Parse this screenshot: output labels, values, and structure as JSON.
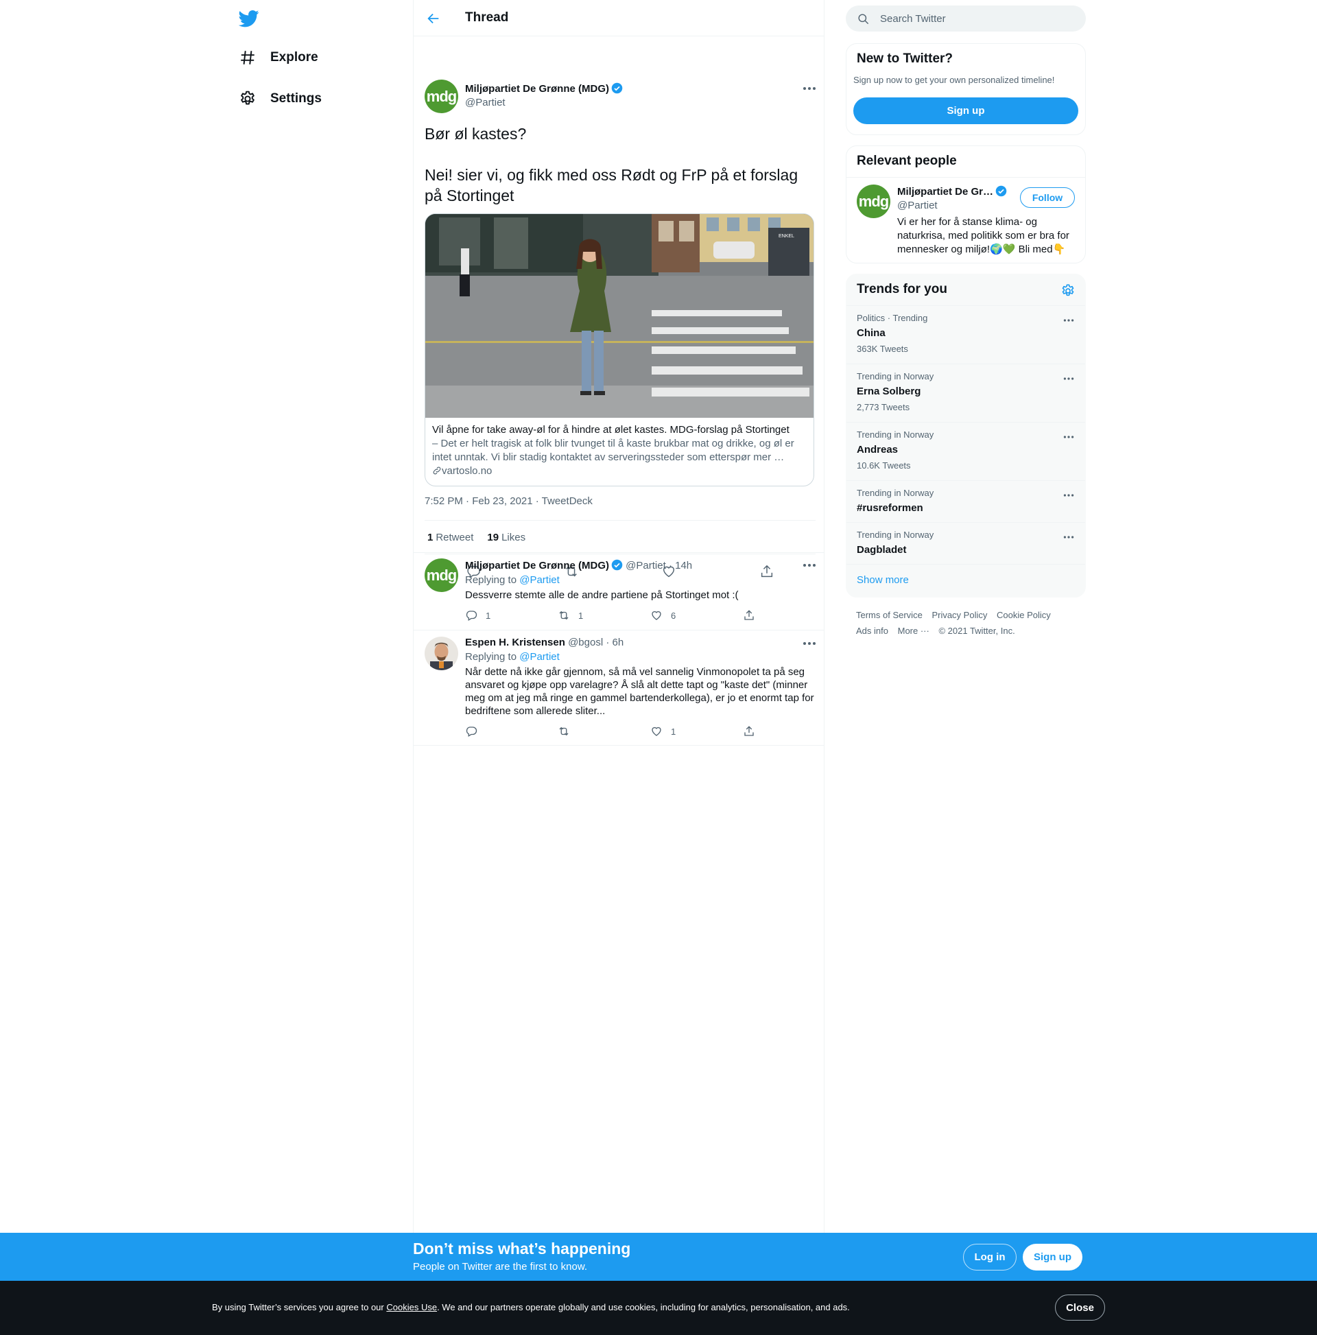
{
  "nav": {
    "items": [
      {
        "label": "Explore",
        "icon": "hashtag-icon"
      },
      {
        "label": "Settings",
        "icon": "gear-icon"
      }
    ]
  },
  "thread": {
    "title": "Thread",
    "main_tweet": {
      "avatar_text": "mdg",
      "name": "Miljøpartiet De Grønne (MDG)",
      "handle": "@Partiet",
      "text_line1": "Bør øl kastes?",
      "text_line2": "Nei! sier vi, og fikk med oss Rødt og FrP på et forslag på Stortinget",
      "card": {
        "title": "Vil åpne for take away-øl for å hindre at ølet kastes. MDG-forslag på Stortinget",
        "description": "– Det er helt tragisk at folk blir tvunget til å kaste brukbar mat og drikke, og øl er intet unntak. Vi blir stadig kontaktet av serveringssteder som etterspør mer …",
        "domain": "vartoslo.no",
        "image_sign": "ENKEL"
      },
      "timestamp": "7:52 PM · Feb 23, 2021",
      "source": "TweetDeck",
      "retweets_count": "1",
      "retweets_label": "Retweet",
      "likes_count": "19",
      "likes_label": "Likes"
    },
    "replies": [
      {
        "avatar_text": "mdg",
        "name": "Miljøpartiet De Grønne (MDG)",
        "handle": "@Partiet",
        "time": "· 14h",
        "replying_label": "Replying to",
        "replying_to": "@Partiet",
        "text": "Dessverre stemte alle de andre partiene på Stortinget mot :(",
        "reply_count": "1",
        "retweet_count": "1",
        "like_count": "6"
      },
      {
        "name": "Espen H. Kristensen",
        "handle": "@bgosl",
        "time": "· 6h",
        "replying_label": "Replying to",
        "replying_to": "@Partiet",
        "text": "Når dette nå ikke går gjennom, så må vel sannelig Vinmonopolet ta på seg ansvaret og kjøpe opp varelagre? Å slå alt dette tapt og \"kaste det\" (minner meg om at jeg må ringe en gammel bartenderkollega), er jo et enormt tap for bedriftene som allerede sliter...",
        "like_count": "1"
      }
    ]
  },
  "sidebar": {
    "search_placeholder": "Search Twitter",
    "new_to_twitter": {
      "title": "New to Twitter?",
      "subtitle": "Sign up now to get your own personalized timeline!",
      "button": "Sign up"
    },
    "relevant_people": {
      "title": "Relevant people",
      "avatar_text": "mdg",
      "name": "Miljøpartiet De Gr…",
      "handle": "@Partiet",
      "follow": "Follow",
      "bio": "Vi er her for å stanse klima- og naturkrisa, med politikk som er bra for mennesker og miljø!🌍💚 Bli med👇"
    },
    "trends": {
      "title": "Trends for you",
      "items": [
        {
          "category": "Politics · Trending",
          "name": "China",
          "count": "363K Tweets"
        },
        {
          "category": "Trending in Norway",
          "name": "Erna Solberg",
          "count": "2,773 Tweets"
        },
        {
          "category": "Trending in Norway",
          "name": "Andreas",
          "count": "10.6K Tweets"
        },
        {
          "category": "Trending in Norway",
          "name": "#rusreformen",
          "count": ""
        },
        {
          "category": "Trending in Norway",
          "name": "Dagbladet",
          "count": ""
        }
      ],
      "show_more": "Show more"
    },
    "footer": {
      "terms": "Terms of Service",
      "privacy": "Privacy Policy",
      "cookie": "Cookie Policy",
      "ads": "Ads info",
      "more": "More ···",
      "copyright": "© 2021 Twitter, Inc."
    }
  },
  "banner": {
    "title": "Don’t miss what’s happening",
    "subtitle": "People on Twitter are the first to know.",
    "login": "Log in",
    "signup": "Sign up"
  },
  "cookie": {
    "text_before": "By using Twitter’s services you agree to our ",
    "link": "Cookies Use",
    "text_after": ". We and our partners operate globally and use cookies, including for analytics, personalisation, and ads.",
    "close": "Close"
  },
  "colors": {
    "accent": "#1d9bf0",
    "mdg_green": "#4e9a31",
    "dark_bar": "#0f1419"
  }
}
